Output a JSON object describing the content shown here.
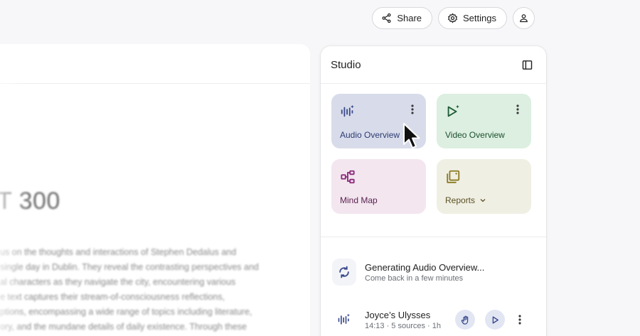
{
  "topbar": {
    "share_label": "Share",
    "settings_label": "Settings"
  },
  "document": {
    "title": "T 300",
    "paragraph": [
      "us on the thoughts and interactions of Stephen Dedalus and",
      "single day in Dublin. They reveal the contrasting perspectives and",
      "al characters as they navigate the city, encountering various",
      "e text captures their stream-of-consciousness reflections,",
      "ptions, encompassing a wide range of topics including literature,",
      "ory, and the mundane details of daily existence. Through these"
    ]
  },
  "studio": {
    "title": "Studio",
    "tiles": [
      {
        "label": "Audio Overview",
        "icon": "audio-waveform-icon"
      },
      {
        "label": "Video Overview",
        "icon": "video-play-icon"
      },
      {
        "label": "Mind Map",
        "icon": "mind-map-icon"
      },
      {
        "label": "Reports",
        "icon": "reports-icon"
      }
    ],
    "generating": {
      "title": "Generating Audio Overview...",
      "subtitle": "Come back in a few minutes"
    },
    "item": {
      "title": "Joyce’s Ulysses",
      "meta": "14:13 · 5 sources · 1h"
    }
  },
  "colors": {
    "audio_tile": "#d8dcea",
    "video_tile": "#dcefe1",
    "mindmap_tile": "#f3e6ef",
    "reports_tile": "#f0efe4",
    "accent_blue": "#3a4a8c"
  }
}
